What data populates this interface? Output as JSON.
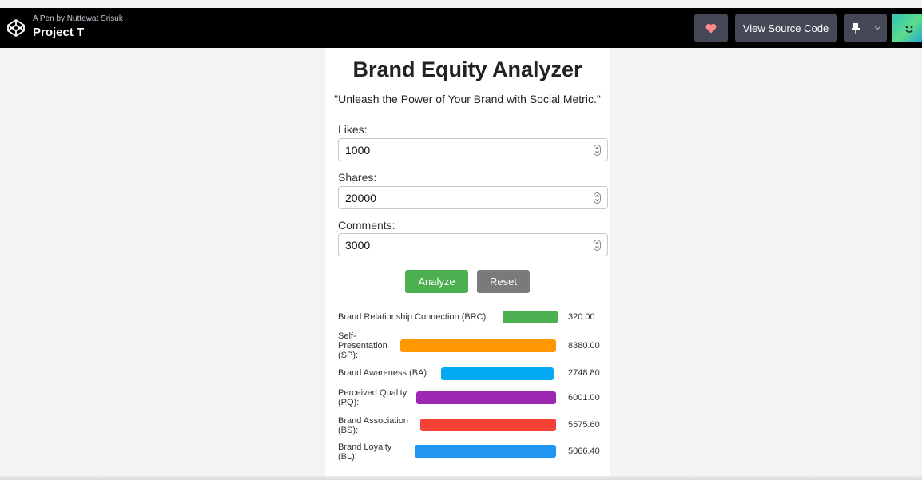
{
  "header": {
    "pen_by": "A Pen by Nuttawat Srisuk",
    "title": "Project T",
    "view_source_label": "View Source Code",
    "heart_color": "#ff8a8a"
  },
  "app": {
    "title": "Brand Equity Analyzer",
    "tagline": "\"Unleash the Power of Your Brand with Social Metric.\"",
    "fields": [
      {
        "label": "Likes:",
        "value": "1000"
      },
      {
        "label": "Shares:",
        "value": "20000"
      },
      {
        "label": "Comments:",
        "value": "3000"
      }
    ],
    "analyze_label": "Analyze",
    "reset_label": "Reset",
    "metrics": [
      {
        "label": "Brand Relationship Connection (BRC):",
        "value": "320.00",
        "color": "#4caf50"
      },
      {
        "label": "Self-Presentation (SP):",
        "value": "8380.00",
        "color": "#ff9800"
      },
      {
        "label": "Brand Awareness (BA):",
        "value": "2748.80",
        "color": "#03a9f4"
      },
      {
        "label": "Perceived Quality (PQ):",
        "value": "6001.00",
        "color": "#9c27b0"
      },
      {
        "label": "Brand Association (BS):",
        "value": "5575.60",
        "color": "#f44336"
      },
      {
        "label": "Brand Loyalty (BL):",
        "value": "5066.40",
        "color": "#2196f3"
      }
    ]
  }
}
